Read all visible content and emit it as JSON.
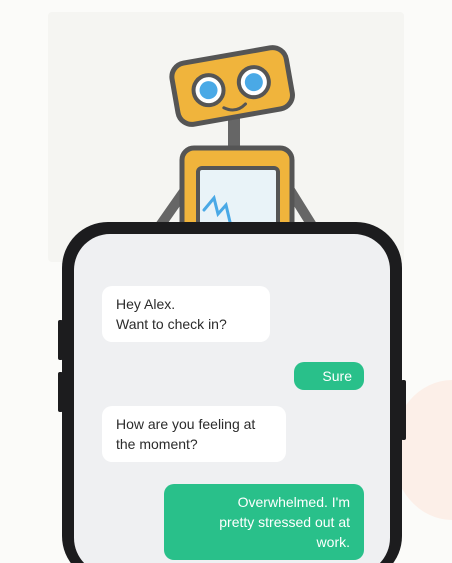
{
  "colors": {
    "accent_green": "#29c08a",
    "robot_yellow": "#f0b43c",
    "robot_outline": "#555555",
    "eye_blue": "#4aa9e6",
    "phone_frame": "#1c1c1e",
    "screen_bg": "#eff0f2"
  },
  "illustration": {
    "icon": "robot-icon"
  },
  "chat": {
    "messages": [
      {
        "sender": "bot",
        "lines": [
          "Hey Alex.",
          "Want to check in?"
        ]
      },
      {
        "sender": "user",
        "lines": [
          "Sure"
        ]
      },
      {
        "sender": "bot",
        "lines": [
          "How are you feeling at",
          "the moment?"
        ]
      },
      {
        "sender": "user",
        "lines": [
          "Overwhelmed. I'm",
          "pretty stressed out at",
          "work."
        ]
      }
    ]
  }
}
